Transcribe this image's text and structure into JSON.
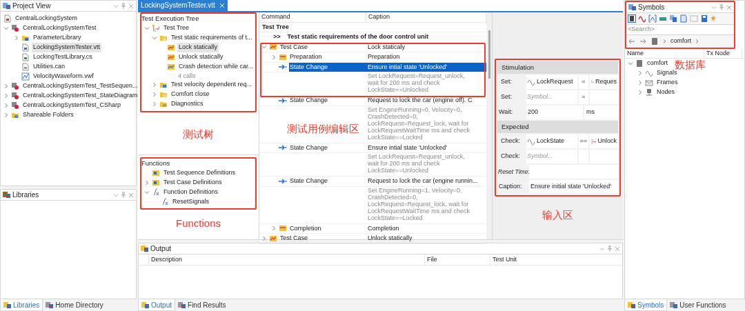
{
  "project_view": {
    "title": "Project View",
    "tree": [
      {
        "label": "CentralLockingSystem",
        "kind": "project",
        "selected": false
      },
      {
        "label": "CentralLockingSystemTest",
        "kind": "test-unit",
        "expanded": true,
        "selected": false,
        "children": [
          {
            "label": "ParameterLibrary",
            "kind": "library",
            "expanded": false,
            "selected": false
          },
          {
            "label": "LockingSystemTester.vtt",
            "kind": "vtt",
            "selected": true
          },
          {
            "label": "LockingTestLibrary.cs",
            "kind": "csharp",
            "selected": false
          },
          {
            "label": "Utilities.can",
            "kind": "can",
            "selected": false
          },
          {
            "label": "VelocityWaveform.vwf",
            "kind": "waveform",
            "selected": false
          }
        ]
      },
      {
        "label": "CentralLockingSystemTest_TestSequen...",
        "kind": "test-unit",
        "expanded": false,
        "selected": false
      },
      {
        "label": "CentralLockingSystemTest_StateDiagram",
        "kind": "test-unit",
        "expanded": false,
        "selected": false
      },
      {
        "label": "CentralLockingSystemTest_CSharp",
        "kind": "test-unit",
        "expanded": false,
        "selected": false
      },
      {
        "label": "Shareable Folders",
        "kind": "shareable",
        "expanded": false,
        "selected": false
      }
    ]
  },
  "libraries": {
    "title": "Libraries"
  },
  "left_tabs": [
    {
      "label": "Libraries",
      "selected": true
    },
    {
      "label": "Home Directory",
      "selected": false
    }
  ],
  "document_tab": {
    "title": "LockingSystemTester.vtt"
  },
  "test_execution_tree": {
    "title": "Test Execution Tree",
    "annotation": "测试树",
    "tree": [
      {
        "label": "Test Tree",
        "kind": "root",
        "expanded": true,
        "selected": false,
        "children": [
          {
            "label": "Test static requirements of t...",
            "kind": "folder",
            "expanded": true,
            "selected": false,
            "children": [
              {
                "label": "Lock statically",
                "kind": "testcase",
                "selected": true
              },
              {
                "label": "Unlock statically",
                "kind": "testcase",
                "selected": false
              },
              {
                "label": "Crash detection while car...",
                "kind": "testcase-list",
                "selected": false,
                "note": "4 calls"
              }
            ]
          },
          {
            "label": "Test velocity dependent req...",
            "kind": "folder-check",
            "expanded": false,
            "selected": false
          },
          {
            "label": "Comfort close",
            "kind": "folder",
            "expanded": false,
            "selected": false
          },
          {
            "label": "Diagnostics",
            "kind": "folder-diag",
            "expanded": false,
            "selected": false
          }
        ]
      }
    ]
  },
  "functions": {
    "title": "Functions",
    "annotation": "Functions",
    "tree": [
      {
        "label": "Test Sequence Definitions",
        "kind": "seq",
        "selected": false
      },
      {
        "label": "Test Case Definitions",
        "kind": "seq",
        "expanded": false,
        "selected": false
      },
      {
        "label": "Function Definitions",
        "kind": "fx",
        "expanded": true,
        "selected": false,
        "children": [
          {
            "label": "ResetSignals",
            "kind": "fx",
            "selected": false
          }
        ]
      }
    ]
  },
  "command_grid": {
    "columns": [
      "Command",
      "Caption"
    ],
    "annotation": "测试用例编辑区",
    "rows": [
      {
        "kind": "title",
        "command": "Test Tree"
      },
      {
        "kind": "group",
        "marker": ">>",
        "command": "Test static requirements of the door control unit"
      },
      {
        "kind": "testcase",
        "command": "Test Case",
        "caption": "Lock staticaly",
        "expanded": true,
        "selected": false,
        "children": [
          {
            "kind": "preparation",
            "command": "Preparation",
            "caption": "Preparation",
            "expanded": false,
            "selected": false
          },
          {
            "kind": "statechange",
            "command": "State Change",
            "caption": "Ensure intial state 'Unlocked'",
            "details": "Set LockRequest=Request_unlock, wait for 200 ms and check LockState==Unlocked",
            "selected": true
          },
          {
            "kind": "statechange",
            "command": "State Change",
            "caption": "Request to lock the car (engine off). C",
            "details": "Set EngineRunning=0, Velocity=0, CrashDetected=0, LockRequest=Request_lock, wait for LockRequestWaitTime ms and check LockState==Locked",
            "selected": false
          },
          {
            "kind": "statechange",
            "command": "State Change",
            "caption": "Ensure intial state 'Unlocked'",
            "details": "Set LockRequest=Request_unlock, wait for 200 ms and check LockState==Unlocked",
            "selected": false
          },
          {
            "kind": "statechange",
            "command": "State Change",
            "caption": "Request to lock the car (engine runnin...",
            "details": "Set EngineRunning=1, Velocity=0, CrashDetected=0, LockRequest=Request_lock, wait for LockRequestWaitTime ms and check LockState==Locked",
            "selected": false
          },
          {
            "kind": "completion",
            "command": "Completion",
            "caption": "Completion",
            "expanded": false,
            "selected": false
          }
        ]
      },
      {
        "kind": "testcase",
        "command": "Test Case",
        "caption": "Unlock statically",
        "expanded": false,
        "selected": false
      }
    ]
  },
  "input_area": {
    "annotation": "输入区",
    "sections": [
      {
        "title": "Stimulation",
        "rows": [
          {
            "label": "Set:",
            "symbol": "LockRequest",
            "operator": "=",
            "value": "Reques"
          },
          {
            "label": "Set:",
            "placeholder": "Symbol...",
            "operator": "="
          }
        ]
      },
      {
        "title": "Expected",
        "before": {
          "label": "Wait:",
          "value": "200",
          "unit": "ms"
        },
        "rows": [
          {
            "label": "Check:",
            "symbol": "LockState",
            "operator": "==",
            "value": "Unlock"
          },
          {
            "label": "Check:",
            "placeholder": "Symbol..."
          }
        ]
      }
    ],
    "reset_time": {
      "label": "Reset Time:"
    },
    "caption": {
      "label": "Caption:",
      "value": "Ensure initial state 'Unlocked'"
    }
  },
  "output": {
    "title": "Output",
    "columns": [
      "Description",
      "File",
      "Test Unit"
    ]
  },
  "center_tabs": [
    {
      "label": "Output",
      "selected": true
    },
    {
      "label": "Find Results",
      "selected": false
    }
  ],
  "symbols": {
    "title": "Symbols",
    "annotation": "数据库",
    "search": {
      "placeholder": "<Search>"
    },
    "breadcrumb": [
      "comfort"
    ],
    "columns": [
      "Name",
      "Tx Node"
    ],
    "tree": [
      {
        "label": "comfort",
        "kind": "db",
        "expanded": true,
        "selected": false,
        "children": [
          {
            "label": "Signals",
            "kind": "signal",
            "expanded": false,
            "selected": false
          },
          {
            "label": "Frames",
            "kind": "frame",
            "expanded": false,
            "selected": false
          },
          {
            "label": "Nodes",
            "kind": "node",
            "expanded": false,
            "selected": false
          }
        ]
      }
    ]
  },
  "right_tabs": [
    {
      "label": "Symbols",
      "selected": true
    },
    {
      "label": "User Functions",
      "selected": false
    }
  ]
}
